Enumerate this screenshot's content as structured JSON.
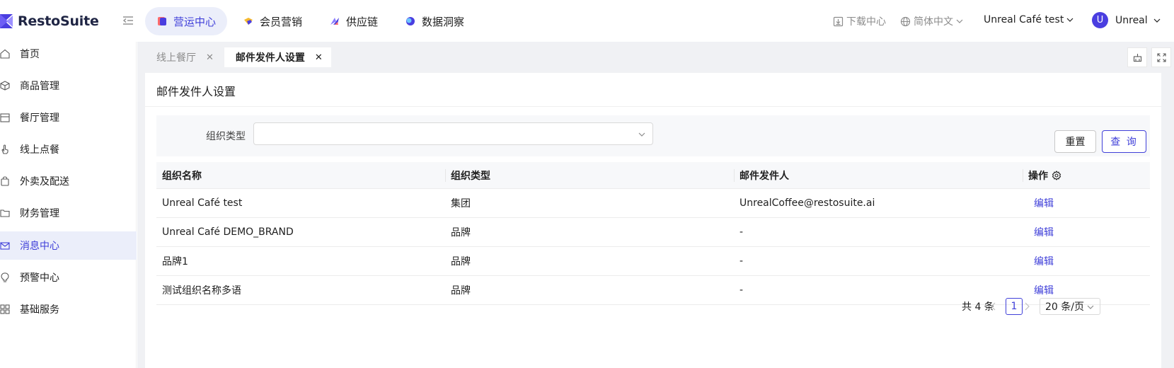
{
  "brand": {
    "name": "RestoSuite"
  },
  "colors": {
    "accent": "#4040d9",
    "active_bg": "#ebeefa",
    "content_bg": "#f0f1f4"
  },
  "topnav": {
    "items": [
      {
        "label": "营运中心",
        "icon": "operations-icon",
        "active": true
      },
      {
        "label": "会员营销",
        "icon": "membership-icon",
        "active": false
      },
      {
        "label": "供应链",
        "icon": "supply-chain-icon",
        "active": false
      },
      {
        "label": "数据洞察",
        "icon": "data-insight-icon",
        "active": false
      }
    ],
    "download": "下载中心",
    "language": "简体中文",
    "store": "Unreal Café test",
    "user_initial": "U",
    "user_name": "Unreal"
  },
  "sidebar": {
    "items": [
      {
        "label": "首页",
        "icon": "home-icon"
      },
      {
        "label": "商品管理",
        "icon": "box-icon"
      },
      {
        "label": "餐厅管理",
        "icon": "store-icon"
      },
      {
        "label": "线上点餐",
        "icon": "hand-pointer-icon"
      },
      {
        "label": "外卖及配送",
        "icon": "bag-icon"
      },
      {
        "label": "财务管理",
        "icon": "folder-icon"
      },
      {
        "label": "消息中心",
        "icon": "mail-icon",
        "active": true
      },
      {
        "label": "预警中心",
        "icon": "bulb-icon"
      },
      {
        "label": "基础服务",
        "icon": "grid-icon"
      }
    ]
  },
  "tabs": [
    {
      "label": "线上餐厅",
      "active": false
    },
    {
      "label": "邮件发件人设置",
      "active": true
    }
  ],
  "page": {
    "title": "邮件发件人设置",
    "filter": {
      "label": "组织类型",
      "value": ""
    },
    "reset_label": "重置",
    "query_label": "查 询"
  },
  "table": {
    "headers": {
      "name": "组织名称",
      "type": "组织类型",
      "sender": "邮件发件人",
      "action": "操作"
    },
    "rows": [
      {
        "name": "Unreal Café test",
        "type": "集团",
        "sender": "UnrealCoffee@restosuite.ai",
        "action": "编辑"
      },
      {
        "name": "Unreal Café DEMO_BRAND",
        "type": "品牌",
        "sender": "-",
        "action": "编辑"
      },
      {
        "name": "品牌1",
        "type": "品牌",
        "sender": "-",
        "action": "编辑"
      },
      {
        "name": "测试组织名称多语",
        "type": "品牌",
        "sender": "-",
        "action": "编辑"
      }
    ]
  },
  "pagination": {
    "total": "共 4 条",
    "current_page": "1",
    "page_size": "20 条/页"
  }
}
